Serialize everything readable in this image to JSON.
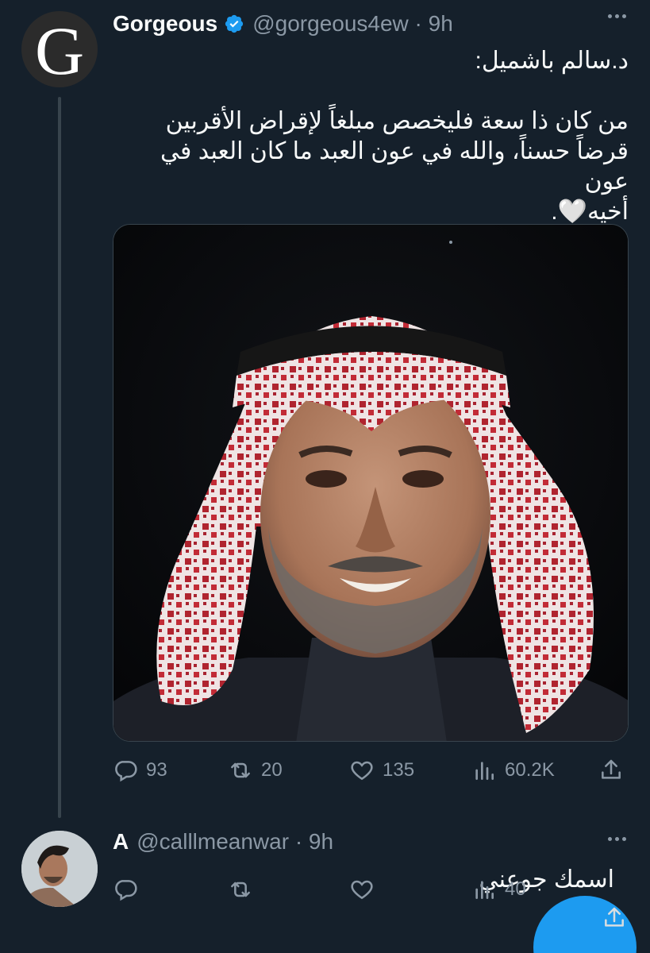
{
  "tweet": {
    "avatar_letter": "G",
    "author_name": "Gorgeous",
    "handle_time": "@gorgeous4ew · 9h",
    "verified": true,
    "text_line1": "د.سالم باشميل:",
    "text_line2": "من كان ذا سعة فليخصص مبلغاً لإقراض الأقربين",
    "text_line3": "قرضاً حسناً، والله في عون العبد ما كان العبد في عون",
    "text_line4": "أخيه🤍.",
    "image_alt": "portrait-photo",
    "actions": {
      "replies": "93",
      "retweets": "20",
      "likes": "135",
      "views": "60.2K"
    }
  },
  "reply": {
    "author_name": "A",
    "handle_time": "@calllmeanwar · 9h",
    "text": "اسمك جوعني",
    "actions": {
      "replies": "",
      "retweets": "",
      "likes": "",
      "views": "40"
    }
  },
  "colors": {
    "background": "#15202b",
    "muted": "#8b98a5",
    "accent": "#1d9bf0",
    "text": "#f7f9f9"
  }
}
